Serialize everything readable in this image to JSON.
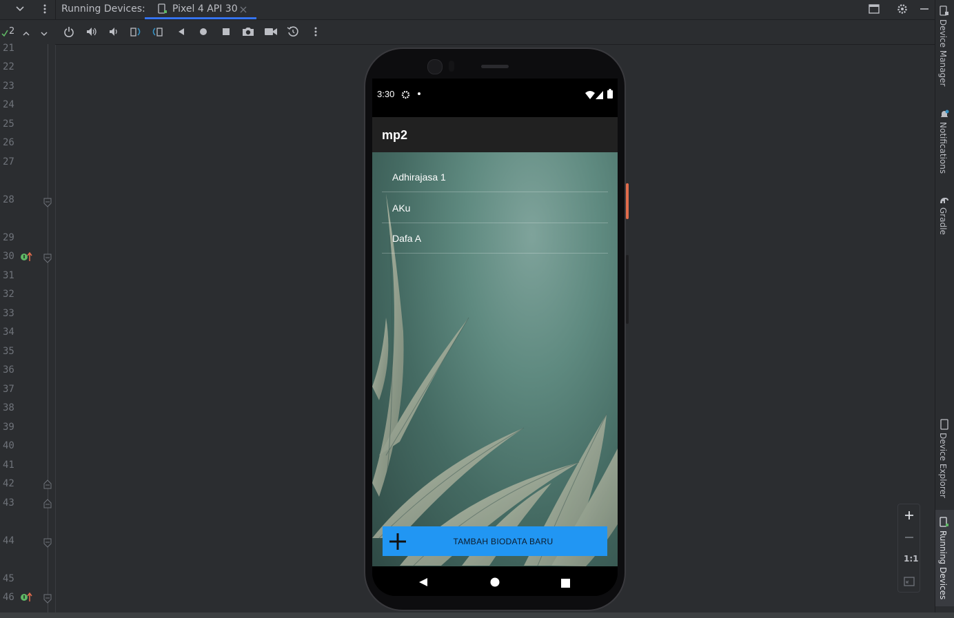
{
  "header": {
    "title": "Running Devices:",
    "tab": {
      "label": "Pixel 4 API 30"
    }
  },
  "gutter": {
    "problems_count": "2",
    "line_numbers": [
      "21",
      "22",
      "23",
      "24",
      "25",
      "26",
      "27",
      "28",
      "29",
      "30",
      "31",
      "32",
      "33",
      "34",
      "35",
      "36",
      "37",
      "38",
      "39",
      "40",
      "41",
      "42",
      "43",
      "44",
      "45",
      "46"
    ]
  },
  "phone": {
    "status": {
      "time": "3:30"
    },
    "app_title": "mp2",
    "list_items": [
      "Adhirajasa 1",
      "AKu",
      "Dafa A"
    ],
    "add_button_label": "TAMBAH BIODATA BARU"
  },
  "right_sidebar": {
    "items": [
      "Device Manager",
      "Notifications",
      "Gradle",
      "Device Explorer",
      "Running Devices"
    ]
  },
  "zoom": {
    "one_to_one": "1:1"
  },
  "colors": {
    "accent": "#3574f0",
    "fab_blue": "#2196f3",
    "gutter_badge": "#5fb865"
  }
}
